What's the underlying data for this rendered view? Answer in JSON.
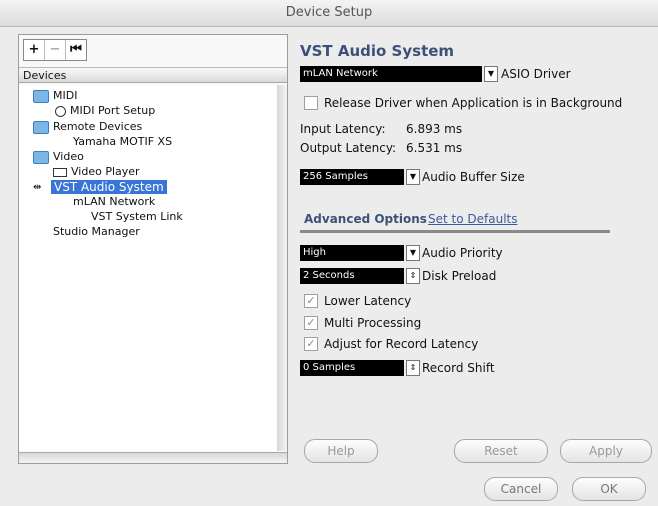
{
  "window": {
    "title": "Device Setup"
  },
  "toolbar": {
    "add": "+",
    "remove": "−",
    "reset": "⏮"
  },
  "tree": {
    "header": "Devices",
    "items": [
      {
        "label": "MIDI"
      },
      {
        "label": "MIDI Port Setup"
      },
      {
        "label": "Remote Devices"
      },
      {
        "label": "Yamaha MOTIF XS"
      },
      {
        "label": "Video"
      },
      {
        "label": "Video Player"
      },
      {
        "label": "VST Audio System"
      },
      {
        "label": "mLAN Network"
      },
      {
        "label": "VST System Link"
      },
      {
        "label": "Studio Manager"
      }
    ]
  },
  "panel": {
    "title": "VST Audio System",
    "asio": {
      "value": "mLAN Network",
      "label": "ASIO Driver"
    },
    "release_driver": {
      "label": "Release Driver when Application is in Background",
      "checked": false
    },
    "input_latency": {
      "label": "Input Latency:",
      "value": "6.893 ms"
    },
    "output_latency": {
      "label": "Output Latency:",
      "value": "6.531 ms"
    },
    "buffer": {
      "value": "256 Samples",
      "label": "Audio Buffer Size"
    },
    "tabs": {
      "advanced": "Advanced Options",
      "defaults": "Set to Defaults"
    },
    "priority": {
      "value": "High",
      "label": "Audio Priority"
    },
    "preload": {
      "value": "2 Seconds",
      "label": "Disk Preload"
    },
    "lower_latency": {
      "label": "Lower Latency",
      "checked": true
    },
    "multi_processing": {
      "label": "Multi Processing",
      "checked": true
    },
    "adjust_record": {
      "label": "Adjust for Record Latency",
      "checked": true
    },
    "record_shift": {
      "value": "0 Samples",
      "label": "Record Shift"
    },
    "check_glyph": "✓"
  },
  "buttons": {
    "help": "Help",
    "reset": "Reset",
    "apply": "Apply",
    "cancel": "Cancel",
    "ok": "OK"
  }
}
